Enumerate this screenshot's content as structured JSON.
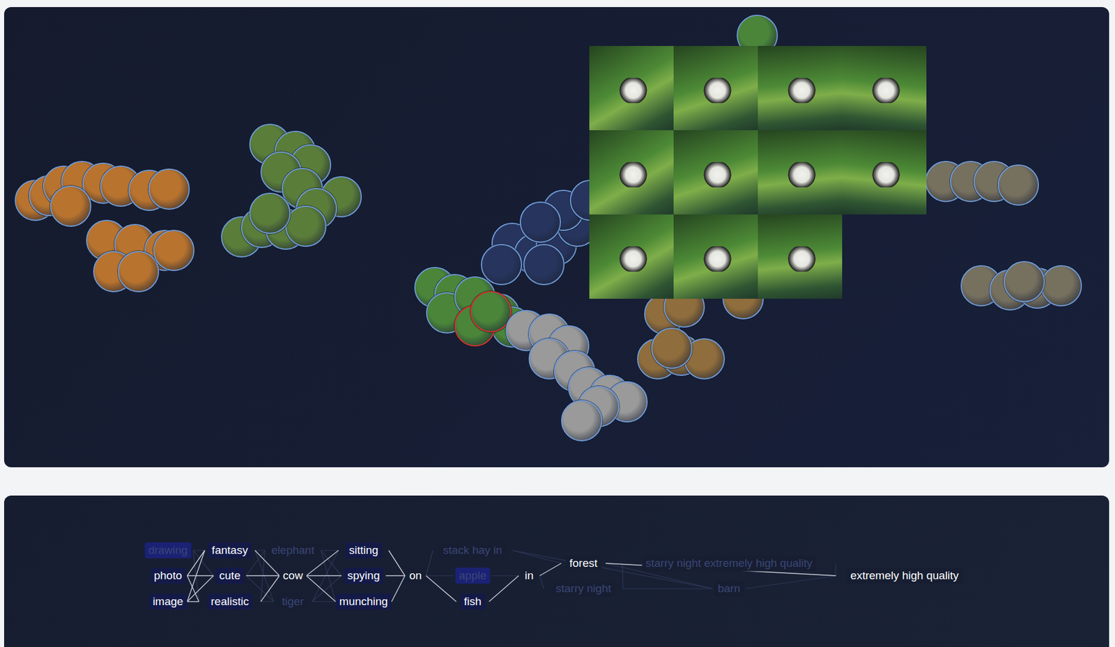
{
  "canvas": {
    "thumbnails": [
      {
        "selected": false
      },
      {
        "selected": false
      },
      {
        "selected": false
      },
      {
        "selected": false
      },
      {
        "selected": false
      },
      {
        "selected": false
      },
      {
        "selected": false
      },
      {
        "selected": false
      },
      {
        "selected": false
      },
      {
        "selected": false
      },
      {
        "selected": false
      },
      {
        "selected": false
      },
      {
        "selected": false
      },
      {
        "selected": false
      },
      {
        "selected": false
      },
      {
        "selected": false
      },
      {
        "selected": false
      },
      {
        "selected": false
      },
      {
        "selected": false
      },
      {
        "selected": false
      },
      {
        "selected": false
      },
      {
        "selected": false
      },
      {
        "selected": false
      },
      {
        "selected": false
      },
      {
        "selected": false
      },
      {
        "selected": false
      },
      {
        "selected": false
      },
      {
        "selected": false
      },
      {
        "selected": false
      },
      {
        "selected": false
      },
      {
        "selected": false
      },
      {
        "selected": false
      },
      {
        "selected": false
      },
      {
        "selected": false
      },
      {
        "selected": false
      },
      {
        "selected": false
      },
      {
        "selected": false
      },
      {
        "selected": false
      },
      {
        "selected": false
      },
      {
        "selected": false
      },
      {
        "selected": false
      },
      {
        "selected": false
      },
      {
        "selected": true
      },
      {
        "selected": true
      },
      {
        "selected": false
      },
      {
        "selected": false
      },
      {
        "selected": false
      },
      {
        "selected": false
      },
      {
        "selected": false
      },
      {
        "selected": false
      },
      {
        "selected": false
      },
      {
        "selected": false
      },
      {
        "selected": false
      },
      {
        "selected": false
      },
      {
        "selected": false
      },
      {
        "selected": false
      },
      {
        "selected": false
      },
      {
        "selected": false
      },
      {
        "selected": false
      },
      {
        "selected": false
      },
      {
        "selected": false
      },
      {
        "selected": false
      },
      {
        "selected": false
      },
      {
        "selected": false
      },
      {
        "selected": false
      },
      {
        "selected": false
      },
      {
        "selected": false
      },
      {
        "selected": false
      },
      {
        "selected": false
      },
      {
        "selected": false
      },
      {
        "selected": false
      }
    ],
    "expanded_images": [
      {
        "selected": false
      },
      {
        "selected": false
      },
      {
        "selected": false
      },
      {
        "selected": false
      },
      {
        "selected": false
      },
      {
        "selected": false
      },
      {
        "selected": false
      },
      {
        "selected": false
      },
      {
        "selected": false
      },
      {
        "selected": false
      },
      {
        "selected": false
      }
    ]
  },
  "prompt_graph": {
    "nodes": [
      {
        "label": "drawing",
        "active": false,
        "highlighted": true
      },
      {
        "label": "photo",
        "active": true,
        "highlighted": true
      },
      {
        "label": "image",
        "active": true,
        "highlighted": true
      },
      {
        "label": "fantasy",
        "active": true,
        "highlighted": true
      },
      {
        "label": "cute",
        "active": true,
        "highlighted": true
      },
      {
        "label": "realistic",
        "active": true,
        "highlighted": true
      },
      {
        "label": "elephant",
        "active": false,
        "highlighted": false
      },
      {
        "label": "cow",
        "active": true,
        "highlighted": false
      },
      {
        "label": "tiger",
        "active": false,
        "highlighted": false
      },
      {
        "label": "sitting",
        "active": true,
        "highlighted": true
      },
      {
        "label": "spying",
        "active": true,
        "highlighted": true
      },
      {
        "label": "munching",
        "active": true,
        "highlighted": true
      },
      {
        "label": "on",
        "active": true,
        "highlighted": false
      },
      {
        "label": "stack hay in",
        "active": false,
        "highlighted": false
      },
      {
        "label": "apple",
        "active": false,
        "highlighted": true
      },
      {
        "label": "fish",
        "active": true,
        "highlighted": true
      },
      {
        "label": "in",
        "active": true,
        "highlighted": false
      },
      {
        "label": "forest",
        "active": true,
        "highlighted": false
      },
      {
        "label": "starry night",
        "active": false,
        "highlighted": false
      },
      {
        "label": "starry night extremely high quality",
        "active": false,
        "highlighted": false
      },
      {
        "label": "barn",
        "active": false,
        "highlighted": false
      },
      {
        "label": "extremely high quality",
        "active": true,
        "highlighted": false
      }
    ],
    "edges": [
      {
        "from": 0,
        "to": 3,
        "active": false
      },
      {
        "from": 0,
        "to": 4,
        "active": false
      },
      {
        "from": 0,
        "to": 5,
        "active": false
      },
      {
        "from": 3,
        "to": 6,
        "active": false
      },
      {
        "from": 4,
        "to": 6,
        "active": false
      },
      {
        "from": 5,
        "to": 6,
        "active": false
      },
      {
        "from": 3,
        "to": 8,
        "active": false
      },
      {
        "from": 4,
        "to": 8,
        "active": false
      },
      {
        "from": 5,
        "to": 8,
        "active": false
      },
      {
        "from": 6,
        "to": 9,
        "active": false
      },
      {
        "from": 6,
        "to": 10,
        "active": false
      },
      {
        "from": 6,
        "to": 11,
        "active": false
      },
      {
        "from": 8,
        "to": 9,
        "active": false
      },
      {
        "from": 8,
        "to": 10,
        "active": false
      },
      {
        "from": 8,
        "to": 11,
        "active": false
      },
      {
        "from": 12,
        "to": 13,
        "active": false
      },
      {
        "from": 12,
        "to": 14,
        "active": false
      },
      {
        "from": 14,
        "to": 16,
        "active": false
      },
      {
        "from": 13,
        "to": 17,
        "active": false
      },
      {
        "from": 13,
        "to": 20,
        "active": false
      },
      {
        "from": 16,
        "to": 18,
        "active": false
      },
      {
        "from": 18,
        "to": 20,
        "active": false
      },
      {
        "from": 17,
        "to": 20,
        "active": false
      },
      {
        "from": 18,
        "to": 19,
        "active": false
      },
      {
        "from": 19,
        "to": 21,
        "active": false
      },
      {
        "from": 20,
        "to": 21,
        "active": false
      },
      {
        "from": 1,
        "to": 3,
        "active": true
      },
      {
        "from": 1,
        "to": 4,
        "active": true
      },
      {
        "from": 1,
        "to": 5,
        "active": true
      },
      {
        "from": 2,
        "to": 3,
        "active": true
      },
      {
        "from": 2,
        "to": 4,
        "active": true
      },
      {
        "from": 2,
        "to": 5,
        "active": true
      },
      {
        "from": 3,
        "to": 7,
        "active": true
      },
      {
        "from": 4,
        "to": 7,
        "active": true
      },
      {
        "from": 5,
        "to": 7,
        "active": true
      },
      {
        "from": 7,
        "to": 9,
        "active": true
      },
      {
        "from": 7,
        "to": 10,
        "active": true
      },
      {
        "from": 7,
        "to": 11,
        "active": true
      },
      {
        "from": 9,
        "to": 12,
        "active": true
      },
      {
        "from": 10,
        "to": 12,
        "active": true
      },
      {
        "from": 11,
        "to": 12,
        "active": true
      },
      {
        "from": 12,
        "to": 15,
        "active": true
      },
      {
        "from": 15,
        "to": 16,
        "active": true
      },
      {
        "from": 16,
        "to": 17,
        "active": true
      },
      {
        "from": 17,
        "to": 21,
        "active": true
      }
    ]
  }
}
